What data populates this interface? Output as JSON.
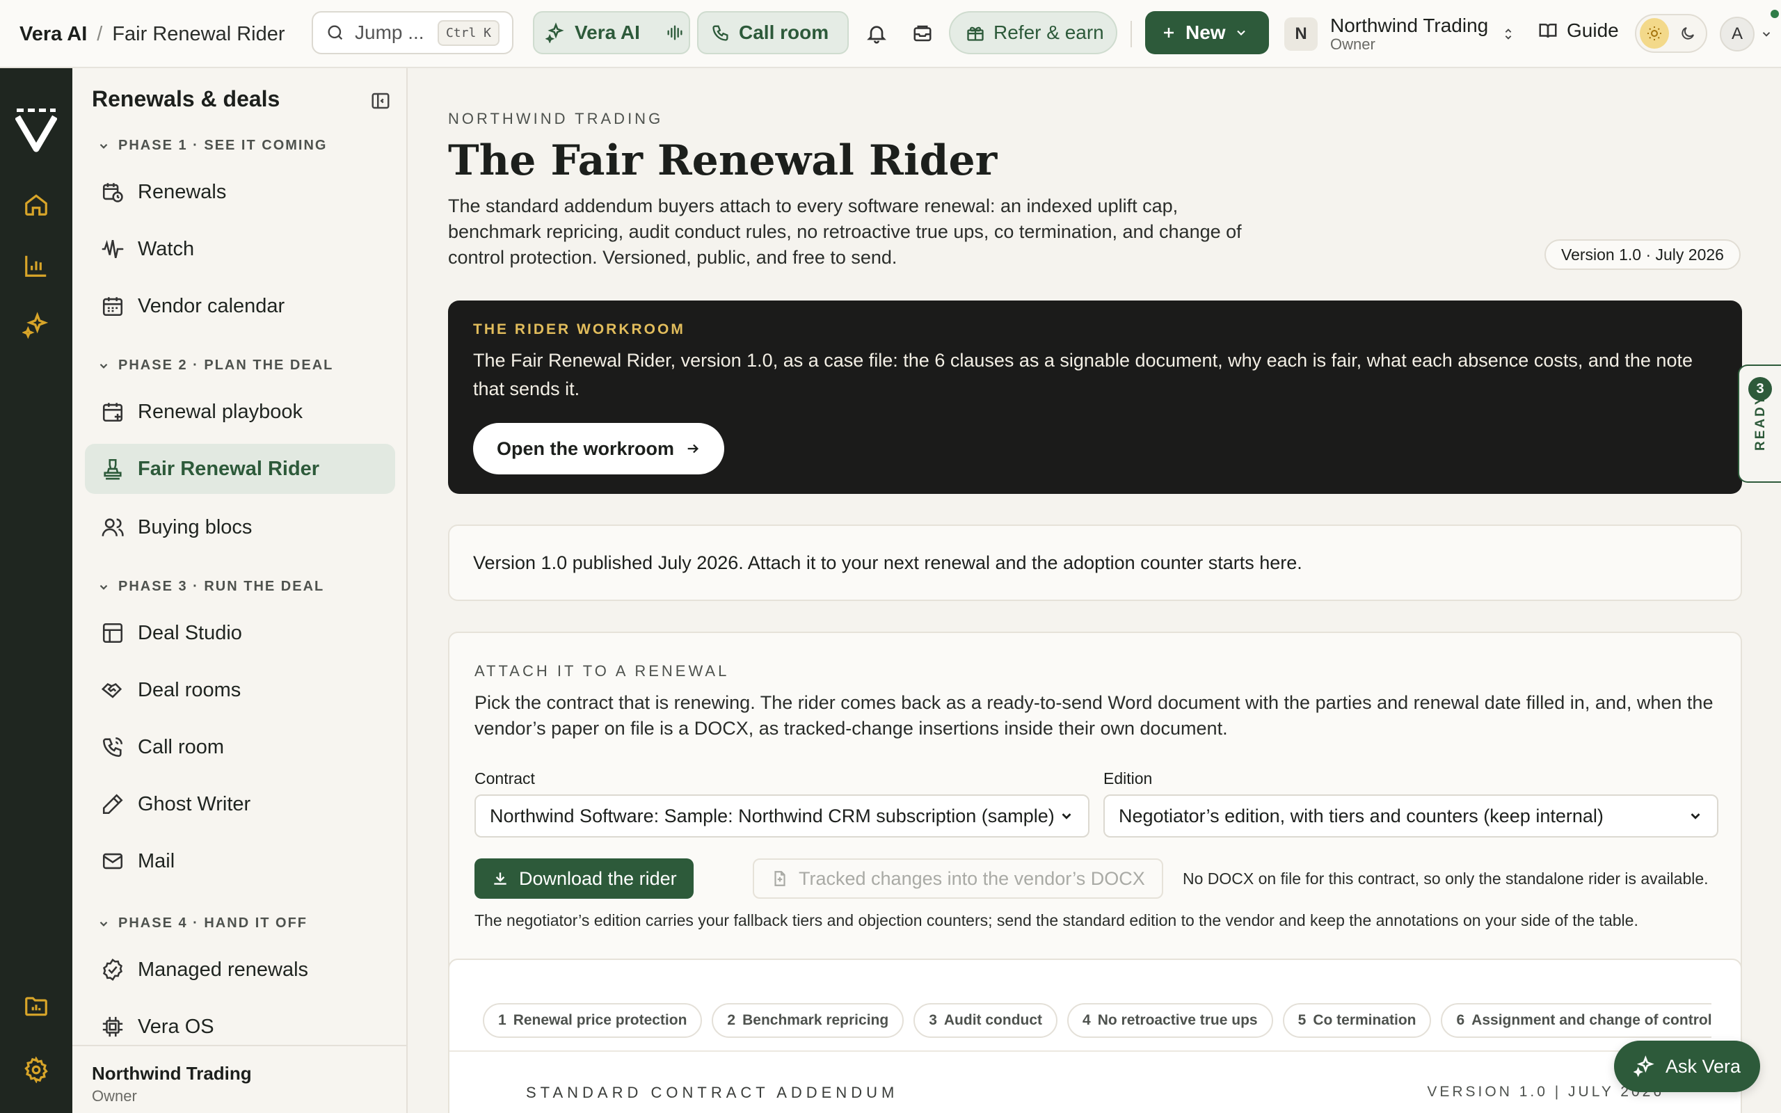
{
  "topbar": {
    "app_name": "Vera AI",
    "breadcrumb_sep": "/",
    "page_name": "Fair Renewal Rider",
    "search_placeholder": "Jump ...",
    "search_shortcut": "Ctrl K",
    "vera_ai_label": "Vera AI",
    "call_room_label": "Call room",
    "refer_label": "Refer & earn",
    "new_label": "New",
    "org_initial": "N",
    "org_name": "Northwind Trading",
    "org_role": "Owner",
    "guide_label": "Guide",
    "avatar_initial": "A",
    "colors": {
      "brand_green": "#2d5a3a",
      "amber": "#d8a529",
      "rail": "#1f2620"
    }
  },
  "rail": {
    "icons": [
      "vera-logo-icon",
      "home-icon",
      "analytics-icon",
      "sparkle-icon",
      "folder-icon",
      "settings-icon"
    ]
  },
  "sidebar": {
    "title": "Renewals & deals",
    "phases": [
      {
        "label": "PHASE 1 · SEE IT COMING",
        "items": [
          {
            "label": "Renewals",
            "icon": "calendar-clock-icon"
          },
          {
            "label": "Watch",
            "icon": "waveform-icon"
          },
          {
            "label": "Vendor calendar",
            "icon": "calendar-icon"
          }
        ]
      },
      {
        "label": "PHASE 2 · PLAN THE DEAL",
        "items": [
          {
            "label": "Renewal playbook",
            "icon": "calendar-plus-icon"
          },
          {
            "label": "Fair Renewal Rider",
            "icon": "stamp-icon",
            "active": true
          },
          {
            "label": "Buying blocs",
            "icon": "users-icon"
          }
        ]
      },
      {
        "label": "PHASE 3 · RUN THE DEAL",
        "items": [
          {
            "label": "Deal Studio",
            "icon": "layout-icon"
          },
          {
            "label": "Deal rooms",
            "icon": "handshake-icon"
          },
          {
            "label": "Call room",
            "icon": "phone-icon"
          },
          {
            "label": "Ghost Writer",
            "icon": "pen-icon"
          },
          {
            "label": "Mail",
            "icon": "mail-icon"
          }
        ]
      },
      {
        "label": "PHASE 4 · HAND IT OFF",
        "items": [
          {
            "label": "Managed renewals",
            "icon": "check-circle-icon"
          },
          {
            "label": "Vera OS",
            "icon": "chip-icon"
          }
        ]
      }
    ],
    "footer_name": "Northwind Trading",
    "footer_role": "Owner"
  },
  "main": {
    "eyebrow": "NORTHWIND TRADING",
    "title": "The Fair Renewal Rider",
    "lede": "The standard addendum buyers attach to every software renewal: an indexed uplift cap, benchmark repricing, audit conduct rules, no retroactive true ups, co termination, and change of control protection. Versioned, public, and free to send.",
    "version_pill": "Version 1.0 · July 2026",
    "workroom": {
      "kicker": "THE RIDER WORKROOM",
      "desc": "The Fair Renewal Rider, version 1.0, as a case file: the 6 clauses as a signable document, why each is fair, what each absence costs, and the note that sends it.",
      "button": "Open the workroom"
    },
    "ready_tab": {
      "count": "3",
      "label": "READY"
    },
    "notice": "Version 1.0 published July 2026. Attach it to your next renewal and the adoption counter starts here.",
    "attach": {
      "kicker": "ATTACH IT TO A RENEWAL",
      "desc": "Pick the contract that is renewing. The rider comes back as a ready-to-send Word document with the parties and renewal date filled in, and, when the vendor’s paper on file is a DOCX, as tracked-change insertions inside their own document.",
      "contract_label": "Contract",
      "contract_value": "Northwind Software: Sample: Northwind CRM subscription (sample)",
      "edition_label": "Edition",
      "edition_value": "Negotiator’s edition, with tiers and counters (keep internal)",
      "download_label": "Download the rider",
      "tracked_label": "Tracked changes into the vendor’s DOCX",
      "no_docx": "No DOCX on file for this contract, so only the standalone rider is available.",
      "edition_note": "The negotiator’s edition carries your fallback tiers and objection counters; send the standard edition to the vendor and keep the annotations on your side of the table."
    },
    "clauses": [
      {
        "num": "1",
        "label": "Renewal price protection"
      },
      {
        "num": "2",
        "label": "Benchmark repricing"
      },
      {
        "num": "3",
        "label": "Audit conduct"
      },
      {
        "num": "4",
        "label": "No retroactive true ups"
      },
      {
        "num": "5",
        "label": "Co termination"
      },
      {
        "num": "6",
        "label": "Assignment and change of control"
      }
    ],
    "doc_kicker": "STANDARD CONTRACT ADDENDUM",
    "doc_version": "VERSION 1.0 | JULY 2026"
  },
  "ask_vera": "Ask Vera"
}
